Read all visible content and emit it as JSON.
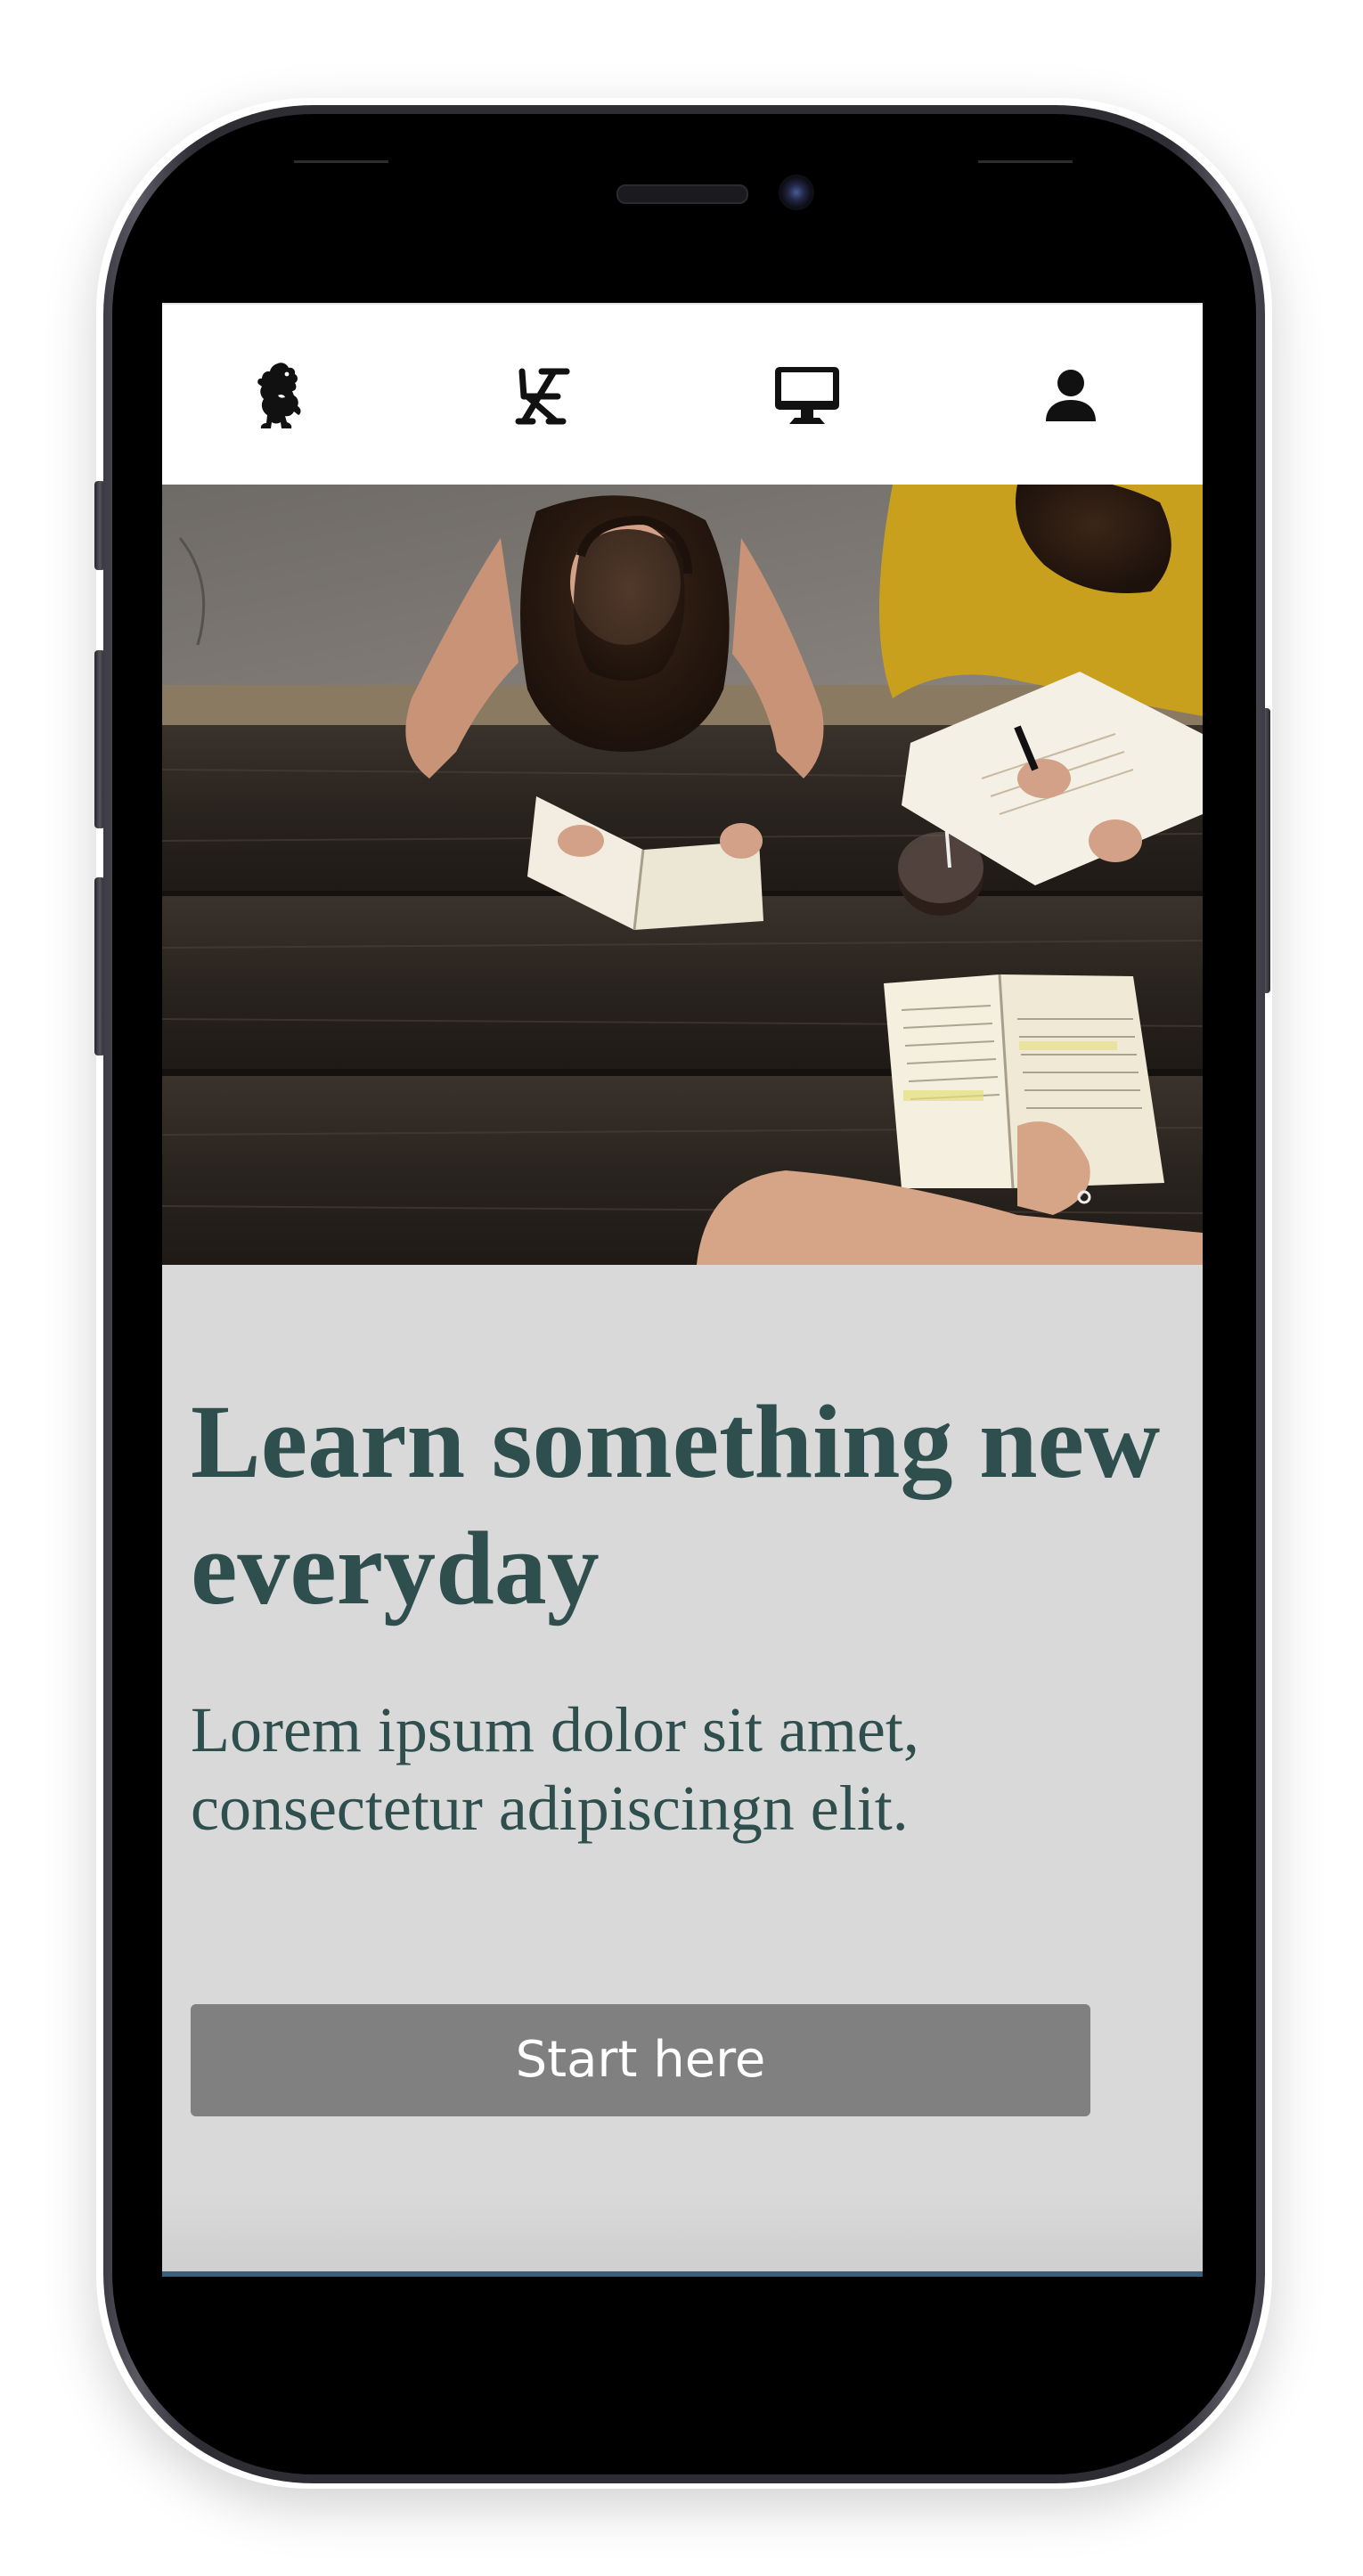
{
  "nav": {
    "items": [
      {
        "icon": "lion-rampant-icon"
      },
      {
        "icon": "desk-chair-icon"
      },
      {
        "icon": "desktop-monitor-icon"
      },
      {
        "icon": "user-icon"
      }
    ]
  },
  "hero": {
    "image": "students-reading-at-wooden-table"
  },
  "main": {
    "headline": "Learn something new everyday",
    "subtext": "Lorem ipsum dolor sit amet, consectetur adipiscingn elit.",
    "cta_label": "Start here"
  },
  "colors": {
    "text": "#2f4f4f",
    "button": "#808080",
    "button_text": "#ffffff",
    "content_bg": "#d9d9d9",
    "nav_bg": "#ffffff"
  }
}
